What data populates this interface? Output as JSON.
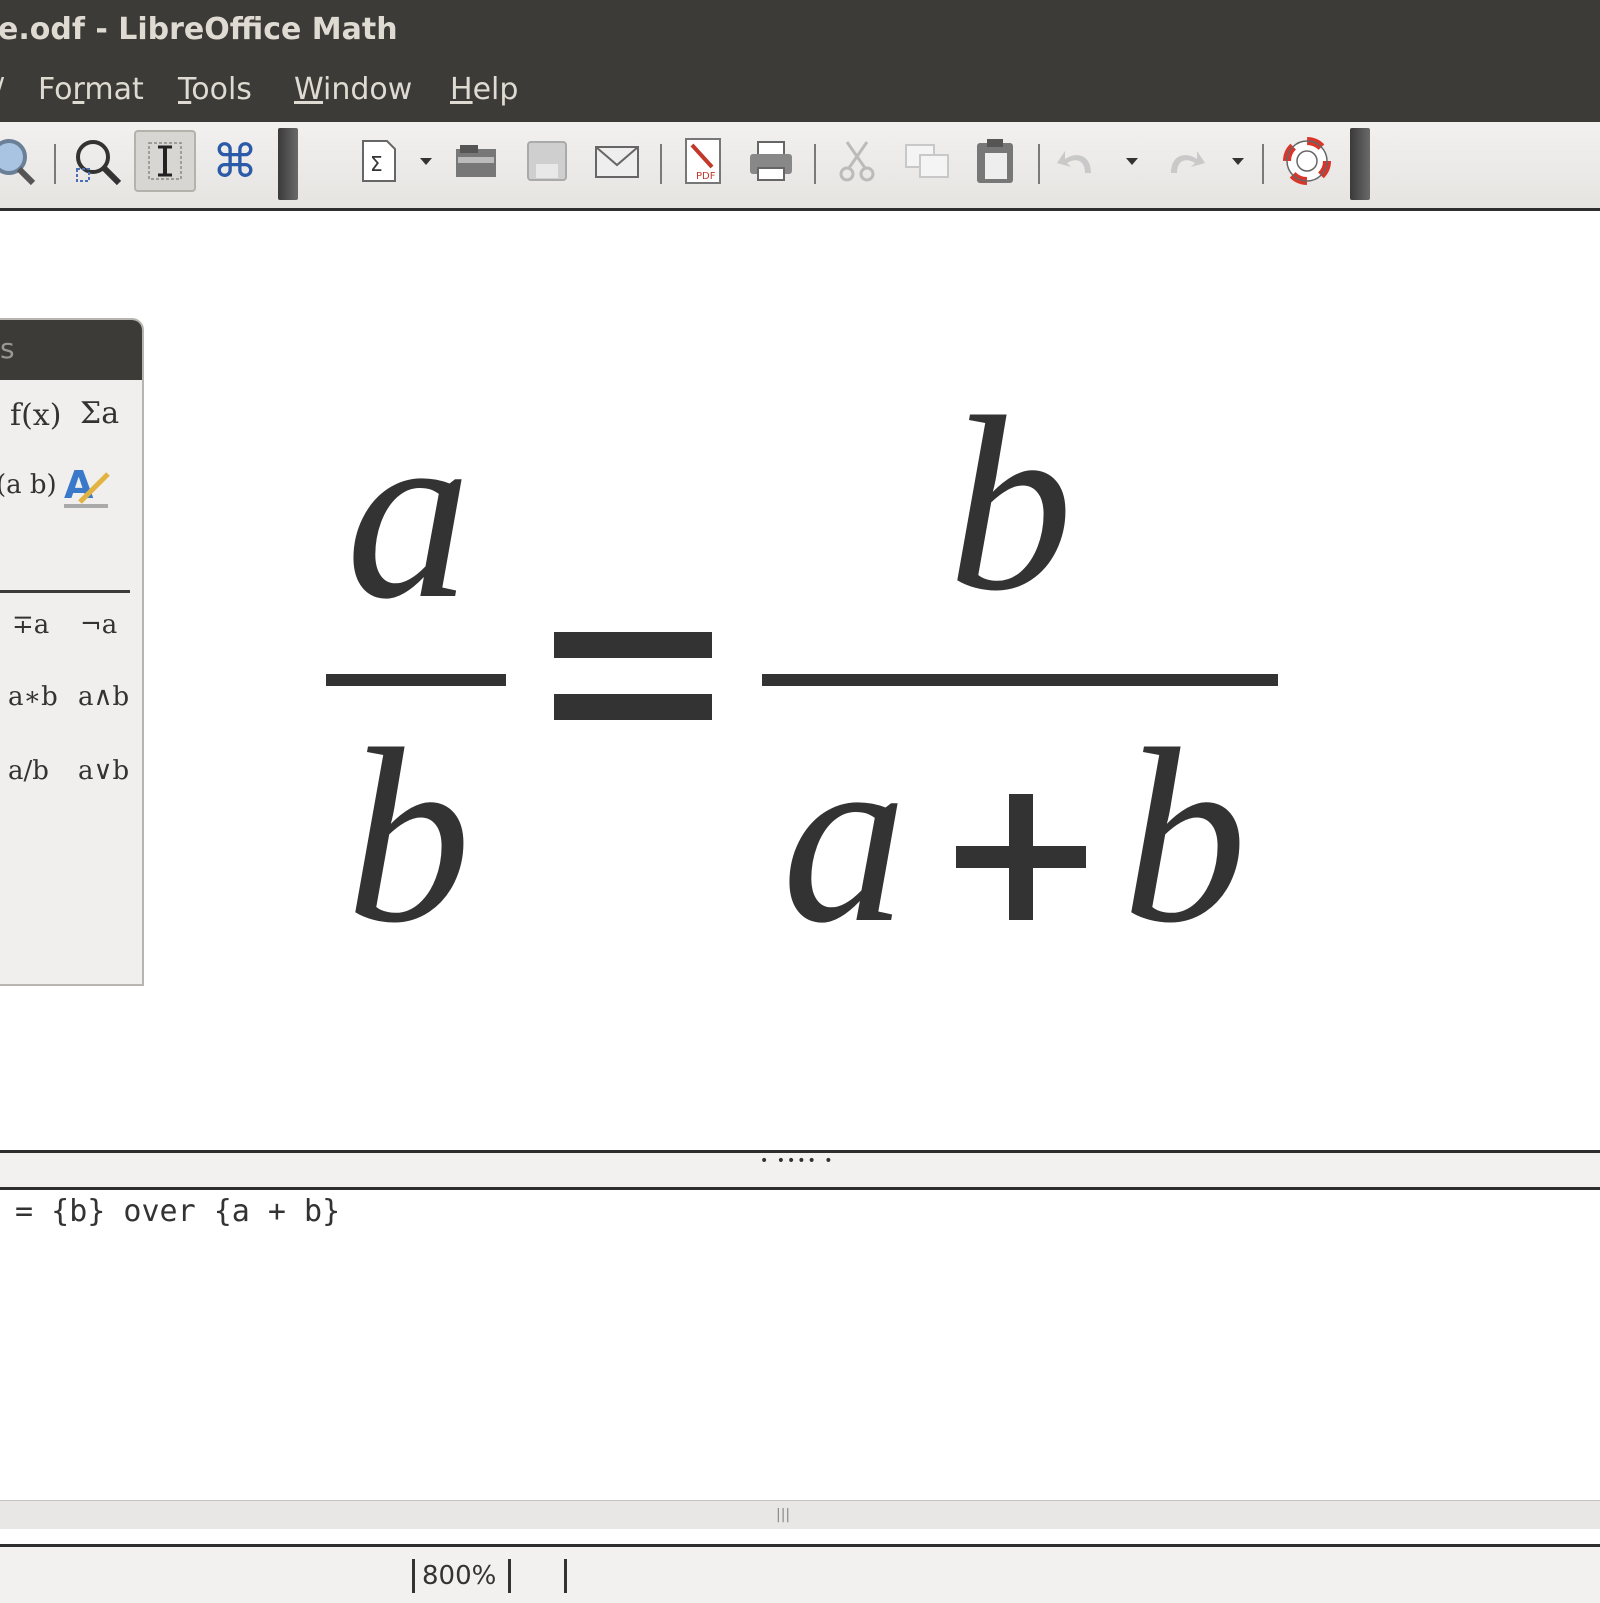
{
  "window": {
    "title": "e.odf - LibreOffice Math"
  },
  "menu": {
    "partial_left": "/",
    "items": [
      {
        "label": "Format",
        "underline": "r"
      },
      {
        "label": "Tools",
        "underline": "T"
      },
      {
        "label": "Window",
        "underline": "W"
      },
      {
        "label": "Help",
        "underline": "H"
      }
    ]
  },
  "toolbar": {
    "icons": [
      "zoom-icon",
      "zoom-search-icon",
      "text-cursor-icon",
      "command-icon",
      "insert-formula-icon",
      "open-folder-icon",
      "save-icon",
      "email-icon",
      "export-pdf-icon",
      "print-icon",
      "cut-icon",
      "copy-icon",
      "paste-icon",
      "undo-icon",
      "redo-icon",
      "help-lifebuoy-icon"
    ]
  },
  "elements_panel": {
    "title": "s",
    "row1": [
      "f(x)",
      "Σa"
    ],
    "row2_right_icon": "attributes-icon",
    "row2_left": "(a b)",
    "row3": [
      "∓a",
      "¬a"
    ],
    "row4": [
      "a∗b",
      "a∧b"
    ],
    "row5": [
      "a/b",
      "a∨b"
    ]
  },
  "formula": {
    "lhs_numerator": "a",
    "lhs_denominator": "b",
    "equals": "=",
    "rhs_numerator": "b",
    "rhs_denominator_a": "a",
    "rhs_plus": "+",
    "rhs_denominator_b": "b"
  },
  "editor": {
    "text": " = {b} over {a + b}"
  },
  "status": {
    "zoom": "800%"
  },
  "colors": {
    "titlebar": "#3c3b37",
    "title_text": "#dfdbd2",
    "formula": "#333333"
  }
}
